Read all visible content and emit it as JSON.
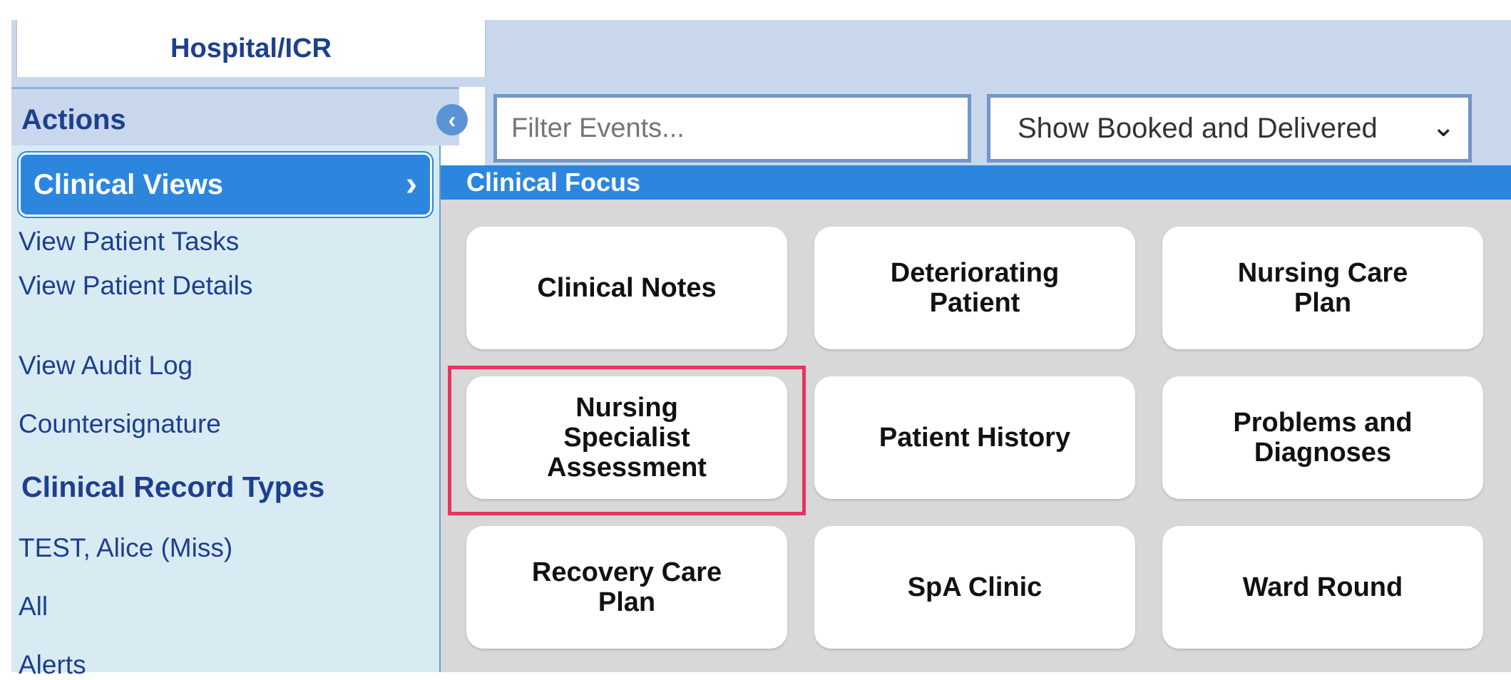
{
  "tabs": [
    {
      "label": "Hospital/ICR",
      "active": true
    }
  ],
  "sidebar": {
    "header": "Actions",
    "collapse_icon": "chevron-left-circle-icon",
    "selected_item": {
      "label": "Clinical Views",
      "icon": "chevron-right-icon"
    },
    "links": [
      {
        "label": "View Patient Tasks"
      },
      {
        "label": "View Patient Details"
      },
      {
        "label": "View Audit Log"
      },
      {
        "label": "Countersignature"
      }
    ],
    "section_title": "Clinical Record Types",
    "record_items": [
      {
        "label": "TEST, Alice (Miss)"
      },
      {
        "label": "All"
      },
      {
        "label": "Alerts"
      }
    ]
  },
  "filter": {
    "placeholder": "Filter Events...",
    "value": "",
    "select_value": "Show Booked and Delivered",
    "select_icon": "chevron-down-icon"
  },
  "focus": {
    "title": "Clinical Focus",
    "tiles": [
      {
        "label": "Clinical Notes"
      },
      {
        "label": "Deteriorating\nPatient"
      },
      {
        "label": "Nursing Care\nPlan"
      },
      {
        "label": "Nursing\nSpecialist\nAssessment",
        "highlighted": true
      },
      {
        "label": "Patient History"
      },
      {
        "label": "Problems and\nDiagnoses"
      },
      {
        "label": "Recovery Care\nPlan"
      },
      {
        "label": "SpA Clinic"
      },
      {
        "label": "Ward Round"
      }
    ]
  },
  "colors": {
    "accent": "#2c86de",
    "header_bg": "#c8d7ec",
    "sidebar_bg": "#d9ebf2",
    "link_text": "#1d3f8f",
    "highlight": "#e8325f"
  }
}
